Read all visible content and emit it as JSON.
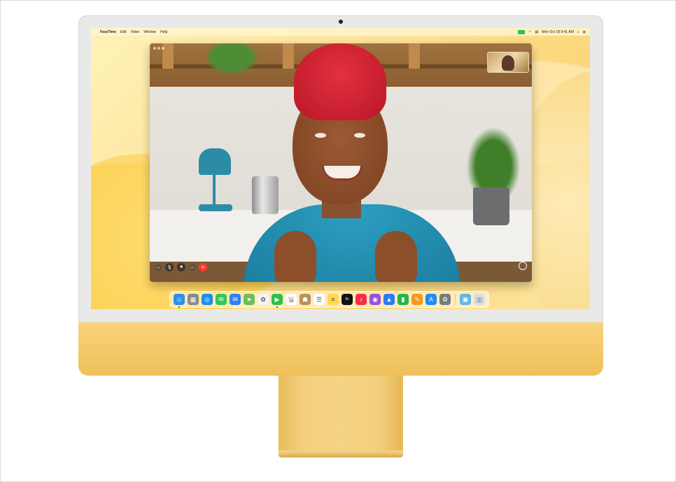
{
  "menubar": {
    "app_name": "FaceTime",
    "menus": [
      "Edit",
      "Video",
      "Window",
      "Help"
    ],
    "clock": "Mon Oct 18  9:41 AM"
  },
  "facetime": {
    "controls": {
      "mute_icon": "microphone-icon",
      "camera_icon": "video-camera-icon",
      "end_icon": "end-call-icon"
    }
  },
  "dock": {
    "calendar_month": "OCT",
    "calendar_day": "18",
    "apple_tv_label": "tv",
    "apps": [
      {
        "name": "finder",
        "color": "#2a8ef0",
        "glyph": "☺"
      },
      {
        "name": "launchpad",
        "color": "#8a8a8a",
        "glyph": "▦"
      },
      {
        "name": "safari",
        "color": "#1a8cf0",
        "glyph": "◎"
      },
      {
        "name": "messages",
        "color": "#34c759",
        "glyph": "✉"
      },
      {
        "name": "mail",
        "color": "#2f7ff5",
        "glyph": "✉"
      },
      {
        "name": "maps",
        "color": "#6bbf59",
        "glyph": "➤"
      },
      {
        "name": "photos",
        "color": "#f4f4f4",
        "glyph": "✿"
      },
      {
        "name": "facetime",
        "color": "#30c04a",
        "glyph": "▶"
      },
      {
        "name": "calendar",
        "color": "#ffffff",
        "glyph": ""
      },
      {
        "name": "contacts",
        "color": "#b9915b",
        "glyph": "☗"
      },
      {
        "name": "reminders",
        "color": "#ffffff",
        "glyph": "☰"
      },
      {
        "name": "notes",
        "color": "#ffd84a",
        "glyph": "≡"
      },
      {
        "name": "apple-tv",
        "color": "#111111",
        "glyph": ""
      },
      {
        "name": "music",
        "color": "#fa2d48",
        "glyph": "♪"
      },
      {
        "name": "podcasts",
        "color": "#9b4fe0",
        "glyph": "◉"
      },
      {
        "name": "keynote",
        "color": "#2b7cf2",
        "glyph": "▲"
      },
      {
        "name": "numbers",
        "color": "#25b64a",
        "glyph": "▮"
      },
      {
        "name": "pages",
        "color": "#f39a1e",
        "glyph": "✎"
      },
      {
        "name": "app-store",
        "color": "#1f8cf4",
        "glyph": "A"
      },
      {
        "name": "system-preferences",
        "color": "#7a7a7a",
        "glyph": "⚙"
      }
    ]
  }
}
